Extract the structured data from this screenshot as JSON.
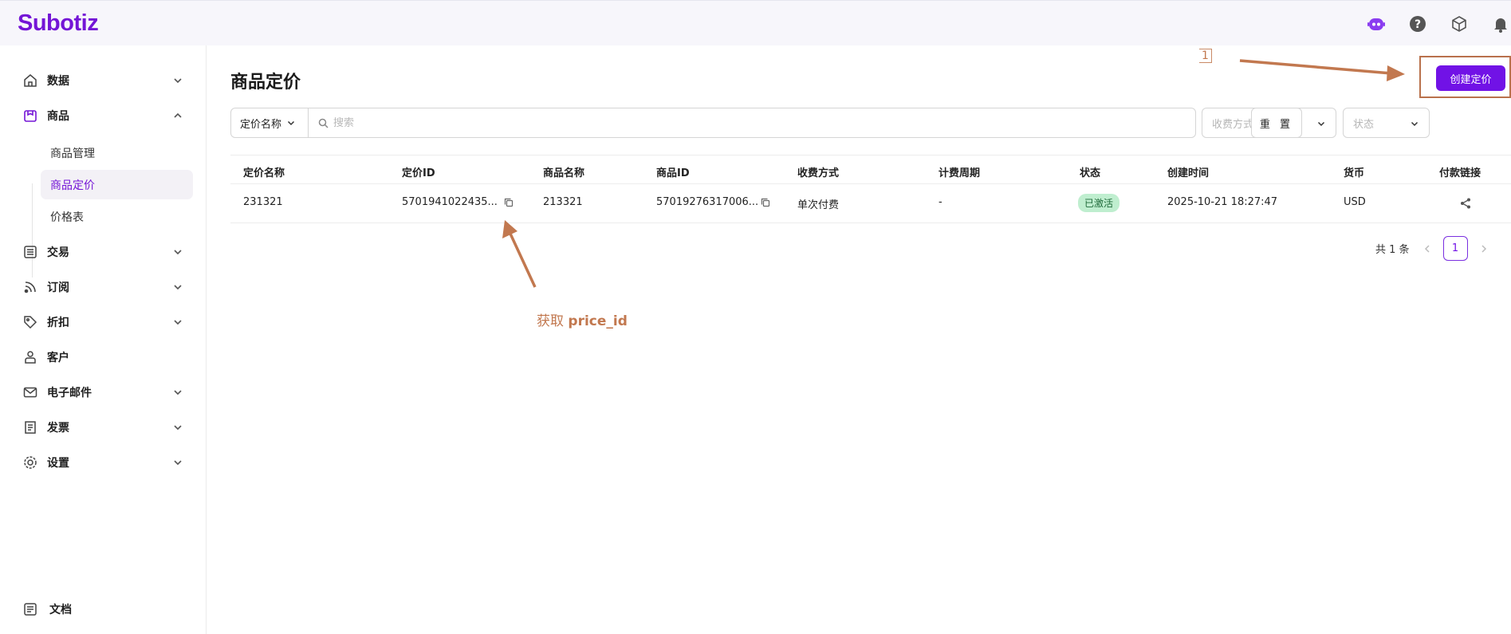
{
  "app": {
    "logo_text": "Subotiz"
  },
  "colors": {
    "brand": "#7415d6",
    "primary_button": "#7112e6",
    "badge_active_bg": "#bfeecf",
    "annotation": "#c2784f"
  },
  "top_icons": [
    "assistant-bot-icon",
    "help-icon",
    "package-box-icon",
    "bell-icon"
  ],
  "sidebar": {
    "items": [
      {
        "label": "数据",
        "icon": "home-icon"
      },
      {
        "label": "商品",
        "icon": "product-box-icon"
      },
      {
        "label": "交易",
        "icon": "list-icon"
      },
      {
        "label": "订阅",
        "icon": "rss-icon"
      },
      {
        "label": "折扣",
        "icon": "tag-icon"
      },
      {
        "label": "客户",
        "icon": "user-icon"
      },
      {
        "label": "电子邮件",
        "icon": "mail-icon"
      },
      {
        "label": "发票",
        "icon": "receipt-icon"
      },
      {
        "label": "设置",
        "icon": "settings-gear-icon"
      }
    ],
    "sub_items": [
      {
        "label": "商品管理"
      },
      {
        "label": "商品定价"
      },
      {
        "label": "价格表"
      }
    ],
    "footer_item": {
      "label": "文档",
      "icon": "document-icon"
    }
  },
  "page": {
    "title": "商品定价",
    "create_button": "创建定价",
    "step_number": "1"
  },
  "filters": {
    "search_field": "定价名称",
    "search_placeholder": "搜索",
    "charge_method_placeholder": "收费方式",
    "status_placeholder": "状态",
    "reset_button": "重 置"
  },
  "table": {
    "columns": [
      "定价名称",
      "定价ID",
      "商品名称",
      "商品ID",
      "收费方式",
      "计费周期",
      "状态",
      "创建时间",
      "货币",
      "付款链接"
    ],
    "rows": [
      {
        "price_name": "231321",
        "price_id": "5701941022435...",
        "product_name": "213321",
        "product_id": "57019276317006...",
        "charge_method": "单次付费",
        "billing_period": "-",
        "status": "已激活",
        "created_at": "2025-10-21 18:27:47",
        "currency": "USD"
      }
    ]
  },
  "pagination": {
    "total_text": "共 1 条",
    "current_page": "1"
  },
  "annotation": {
    "prefix": "获取",
    "code": "price_id"
  }
}
